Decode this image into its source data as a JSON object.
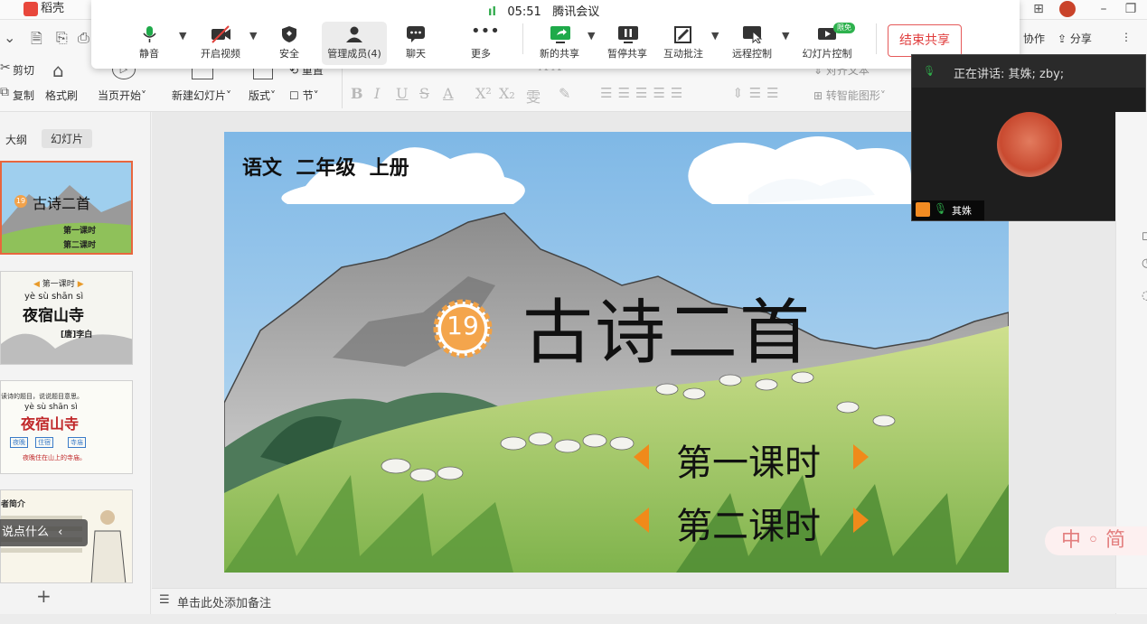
{
  "app": {
    "name": "稻壳"
  },
  "meeting": {
    "time": "05:51",
    "title": "腾讯会议",
    "buttons": [
      {
        "label": "静音",
        "icon": "microphone-icon"
      },
      {
        "label": "开启视频",
        "icon": "video-off-icon"
      },
      {
        "label": "安全",
        "icon": "shield-icon"
      },
      {
        "label": "管理成员(4)",
        "icon": "members-icon"
      },
      {
        "label": "聊天",
        "icon": "chat-icon"
      },
      {
        "label": "更多",
        "icon": "more-icon"
      },
      {
        "label": "新的共享",
        "icon": "new-share-icon"
      },
      {
        "label": "暂停共享",
        "icon": "pause-icon"
      },
      {
        "label": "互动批注",
        "icon": "annotate-icon"
      },
      {
        "label": "远程控制",
        "icon": "remote-control-icon"
      },
      {
        "label": "幻灯片控制",
        "icon": "slide-control-icon",
        "badge": "限免"
      }
    ],
    "end_share": "结束共享"
  },
  "ribbon": {
    "right": {
      "collab": "协作",
      "share": "分享"
    },
    "cut": "剪切",
    "copy": "复制",
    "format_painter": "格式刷",
    "from_current": "当页开始",
    "new_slide": "新建幻灯片",
    "layout": "版式",
    "section": "节",
    "reset": "重置",
    "align_text": "对齐文本",
    "smart_shape": "转智能图形"
  },
  "video": {
    "speaking": "正在讲话: 其姝; zby;",
    "participant": "其姝"
  },
  "panel": {
    "tabs": [
      "大纲",
      "幻灯片"
    ],
    "slides": [
      {
        "title": "古诗二首",
        "num": "19",
        "lines": [
          "第一课时",
          "第二课时"
        ]
      },
      {
        "head": "第一课时",
        "pinyin": "yè sù shān sì",
        "title": "夜宿山寺",
        "author": "[唐]李白"
      },
      {
        "text": "读诗的题目，说说题目意思。",
        "pinyin": "yè sù shān sì",
        "title": "夜宿山寺",
        "tags": [
          "夜晚",
          "住宿",
          "寺庙"
        ],
        "caption": "夜晚住在山上的寺庙。"
      },
      {
        "head": "者简介"
      }
    ],
    "overlay_text": "说点什么",
    "add": "+"
  },
  "slide": {
    "corner": "语文  二年级  上册",
    "lesson_num": "19",
    "title": "古诗二首",
    "lesson1": "第一课时",
    "lesson2": "第二课时"
  },
  "ime": {
    "text": "中 ◦ 简"
  },
  "notes": {
    "placeholder": "单击此处添加备注"
  }
}
